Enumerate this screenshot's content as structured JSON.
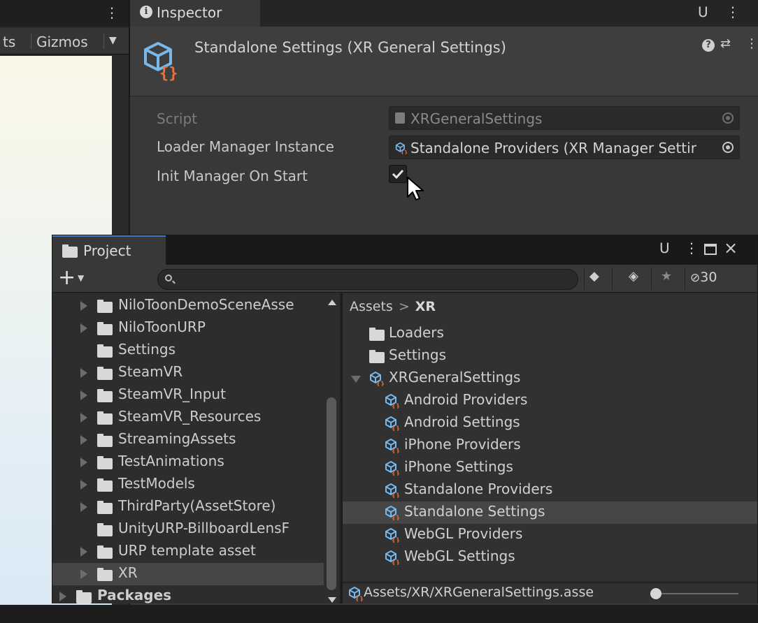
{
  "scene": {
    "toolbar_cut_label": "ts",
    "gizmos_label": "Gizmos",
    "kebab_icon": "kebab-menu-icon",
    "dropdown_icon": "dropdown-arrow-icon"
  },
  "inspector": {
    "tab_label": "Inspector",
    "header_title": "Standalone Settings (XR General Settings)",
    "props": {
      "script_label": "Script",
      "script_value": "XRGeneralSettings",
      "loader_label": "Loader Manager Instance",
      "loader_value": "Standalone Providers (XR Manager Settir",
      "init_label": "Init Manager On Start",
      "init_checked": true
    }
  },
  "project": {
    "tab_label": "Project",
    "search_placeholder": "",
    "hidden_count": "30",
    "tree": [
      {
        "label": "NiloToonDemoSceneAsse",
        "arrow": true,
        "bold": false,
        "selected": false
      },
      {
        "label": "NiloToonURP",
        "arrow": true,
        "bold": false,
        "selected": false
      },
      {
        "label": "Settings",
        "arrow": false,
        "bold": false,
        "selected": false
      },
      {
        "label": "SteamVR",
        "arrow": true,
        "bold": false,
        "selected": false
      },
      {
        "label": "SteamVR_Input",
        "arrow": true,
        "bold": false,
        "selected": false
      },
      {
        "label": "SteamVR_Resources",
        "arrow": true,
        "bold": false,
        "selected": false
      },
      {
        "label": "StreamingAssets",
        "arrow": true,
        "bold": false,
        "selected": false
      },
      {
        "label": "TestAnimations",
        "arrow": true,
        "bold": false,
        "selected": false
      },
      {
        "label": "TestModels",
        "arrow": true,
        "bold": false,
        "selected": false
      },
      {
        "label": "ThirdParty(AssetStore)",
        "arrow": true,
        "bold": false,
        "selected": false
      },
      {
        "label": "UnityURP-BillboardLensF",
        "arrow": false,
        "bold": false,
        "selected": false
      },
      {
        "label": "URP template asset",
        "arrow": true,
        "bold": false,
        "selected": false
      },
      {
        "label": "XR",
        "arrow": true,
        "bold": false,
        "selected": true
      },
      {
        "label": "Packages",
        "arrow": true,
        "bold": true,
        "selected": false,
        "root": true
      }
    ],
    "breadcrumb": {
      "root": "Assets",
      "separator": ">",
      "current": "XR"
    },
    "assets": [
      {
        "label": "Loaders",
        "kind": "folder",
        "indent": 1
      },
      {
        "label": "Settings",
        "kind": "folder",
        "indent": 1
      },
      {
        "label": "XRGeneralSettings",
        "kind": "asset",
        "indent": 1,
        "expanded": true
      },
      {
        "label": "Android Providers",
        "kind": "asset",
        "indent": 2
      },
      {
        "label": "Android Settings",
        "kind": "asset",
        "indent": 2
      },
      {
        "label": "iPhone Providers",
        "kind": "asset",
        "indent": 2
      },
      {
        "label": "iPhone Settings",
        "kind": "asset",
        "indent": 2
      },
      {
        "label": "Standalone Providers",
        "kind": "asset",
        "indent": 2
      },
      {
        "label": "Standalone Settings",
        "kind": "asset",
        "indent": 2,
        "selected": true
      },
      {
        "label": "WebGL Providers",
        "kind": "asset",
        "indent": 2
      },
      {
        "label": "WebGL Settings",
        "kind": "asset",
        "indent": 2
      }
    ],
    "status_path": "Assets/XR/XRGeneralSettings.asse"
  },
  "colors": {
    "accent_blue": "#3a79bb",
    "icon_blue": "#79b8ea",
    "icon_orange": "#e8743b",
    "selection": "#464646"
  }
}
